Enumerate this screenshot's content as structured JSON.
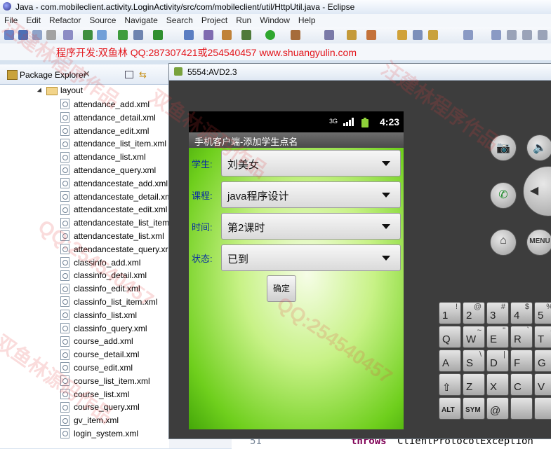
{
  "window": {
    "title": "Java - com.mobileclient.activity.LoginActivity/src/com/mobileclient/util/HttpUtil.java - Eclipse"
  },
  "menu": [
    "File",
    "Edit",
    "Refactor",
    "Source",
    "Navigate",
    "Search",
    "Project",
    "Run",
    "Window",
    "Help"
  ],
  "banner": {
    "text": "程序开发:双鱼林 QQ:287307421或254540457 www.shuangyulin.com"
  },
  "package_explorer": {
    "tab_label": "Package Explorer",
    "close": "✕",
    "folder": "layout",
    "files": [
      "attendance_add.xml",
      "attendance_detail.xml",
      "attendance_edit.xml",
      "attendance_list_item.xml",
      "attendance_list.xml",
      "attendance_query.xml",
      "attendancestate_add.xml",
      "attendancestate_detail.xm",
      "attendancestate_edit.xml",
      "attendancestate_list_item",
      "attendancestate_list.xml",
      "attendancestate_query.xr",
      "classinfo_add.xml",
      "classinfo_detail.xml",
      "classinfo_edit.xml",
      "classinfo_list_item.xml",
      "classinfo_list.xml",
      "classinfo_query.xml",
      "course_add.xml",
      "course_detail.xml",
      "course_edit.xml",
      "course_list_item.xml",
      "course_list.xml",
      "course_query.xml",
      "gv_item.xml",
      "login_system.xml"
    ]
  },
  "emulator": {
    "title": "5554:AVD2.3",
    "status_time": "4:23",
    "network": "3G",
    "app_title": "手机客户端-添加学生点名",
    "fields": [
      {
        "label": "学生:",
        "value": "刘美女"
      },
      {
        "label": "课程:",
        "value": "java程序设计"
      },
      {
        "label": "时间:",
        "value": "第2课时"
      },
      {
        "label": "状态:",
        "value": "已到"
      }
    ],
    "confirm_label": "确定",
    "menu_key": "MENU",
    "keyboard": {
      "row1": [
        [
          "1",
          "!"
        ],
        [
          "2",
          "@"
        ],
        [
          "3",
          "#"
        ],
        [
          "4",
          "$"
        ],
        [
          "5",
          "%"
        ]
      ],
      "row2": [
        [
          "Q",
          ""
        ],
        [
          "W",
          "~"
        ],
        [
          "E",
          "\""
        ],
        [
          "R",
          "`"
        ],
        [
          "T",
          "{"
        ]
      ],
      "row3": [
        [
          "A",
          ""
        ],
        [
          "S",
          "\\"
        ],
        [
          "D",
          "|"
        ],
        [
          "F",
          ""
        ],
        [
          "G",
          ""
        ]
      ],
      "row4": [
        [
          "⇧",
          ""
        ],
        [
          "Z",
          ""
        ],
        [
          "X",
          ""
        ],
        [
          "C",
          ""
        ],
        [
          "V",
          ""
        ]
      ],
      "row5": [
        [
          "ALT",
          ""
        ],
        [
          "SYM",
          ""
        ],
        [
          "@",
          ""
        ],
        [
          "",
          ""
        ],
        [
          "",
          ""
        ]
      ]
    }
  },
  "editor": {
    "line_number": "51",
    "keyword": "throws",
    "code": "ClientProtocolException"
  },
  "watermarks": [
    "QQ:254540457",
    "汪建林程序作品",
    "双鱼林源码作品",
    "QQ:254540457",
    "汪建林程序作品",
    "双鱼林源码作品"
  ]
}
